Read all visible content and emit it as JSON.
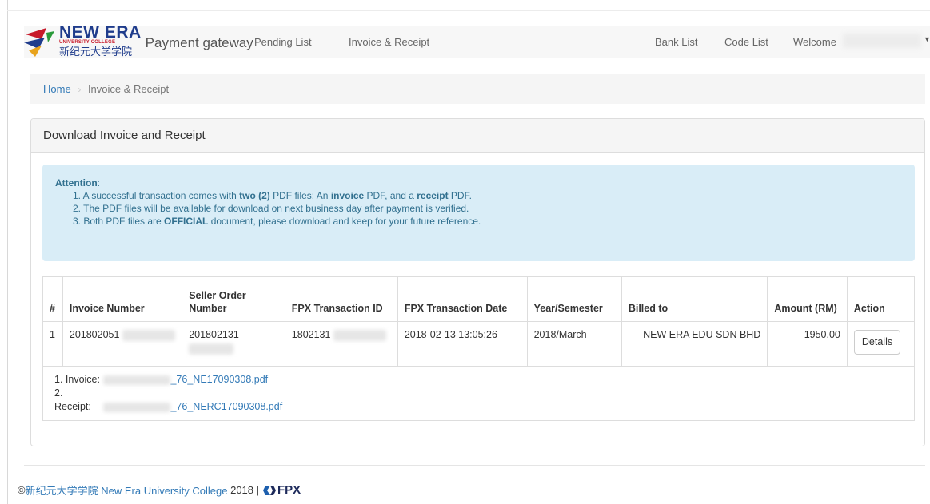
{
  "navbar": {
    "logo_en": "NEW ERA",
    "logo_sub": "UNIVERSITY COLLEGE",
    "logo_cn": "新纪元大学学院",
    "brand_title": "Payment gateway",
    "items": [
      "Pending List",
      "Invoice & Receipt",
      "Bank List",
      "Code List",
      "Welcome"
    ]
  },
  "breadcrumb": {
    "home": "Home",
    "separator": "›",
    "current": "Invoice & Receipt"
  },
  "panel": {
    "heading": "Download Invoice and Receipt",
    "attention": {
      "title": "Attention",
      "item1_a": "1. A successful transaction comes with ",
      "item1_b": "two (2)",
      "item1_c": " PDF files: An ",
      "item1_d": "invoice",
      "item1_e": " PDF, and a ",
      "item1_f": "receipt",
      "item1_g": " PDF.",
      "item2": "2. The PDF files will be available for download on next business day after payment is verified.",
      "item3_a": "3. Both PDF files are ",
      "item3_b": "OFFICIAL",
      "item3_c": " document, please download and keep for your future reference."
    }
  },
  "table": {
    "headers": [
      "#",
      "Invoice Number",
      "Seller Order Number",
      "FPX Transaction ID",
      "FPX Transaction Date",
      "Year/Semester",
      "Billed to",
      "Amount (RM)",
      "Action"
    ],
    "rows": [
      {
        "no": "1",
        "invoice": "201802051",
        "seller_order": "201802131",
        "fpx_id": "1802131",
        "fpx_date": "2018-02-13 13:05:26",
        "year_sem": "2018/March",
        "billed_to": "NEW ERA EDU SDN BHD",
        "amount": "1950.00",
        "action": "Details"
      }
    ],
    "files": {
      "invoice_label": "1. Invoice:",
      "invoice_file": "_76_NE17090308.pdf",
      "receipt_label": "2. Receipt:",
      "receipt_file": "_76_NERC17090308.pdf"
    }
  },
  "footer": {
    "copyright": "©",
    "college_cn": "新纪元大学学院",
    "college_en": "New Era University College",
    "year": "2018 |",
    "fpx": "FPX"
  },
  "colors": {
    "link": "#337ab7",
    "alert_bg": "#d9edf7",
    "alert_text": "#31708f",
    "logo_blue": "#1f3c8c",
    "logo_red": "#c71a2a"
  }
}
